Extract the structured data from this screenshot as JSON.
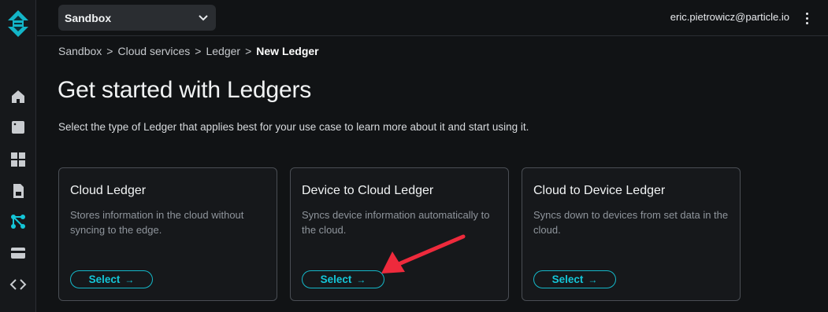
{
  "topbar": {
    "org_selector": "Sandbox",
    "user_email": "eric.pietrowicz@particle.io"
  },
  "breadcrumb": [
    "Sandbox",
    "Cloud services",
    "Ledger",
    "New Ledger"
  ],
  "page": {
    "title": "Get started with Ledgers",
    "subtitle": "Select the type of Ledger that applies best for your use case to learn more about it and start using it."
  },
  "cards": [
    {
      "title": "Cloud Ledger",
      "description": "Stores information in the cloud without syncing to the edge.",
      "button": "Select"
    },
    {
      "title": "Device to Cloud Ledger",
      "description": "Syncs device information automatically to the cloud.",
      "button": "Select"
    },
    {
      "title": "Cloud to Device Ledger",
      "description": "Syncs down to devices from set data in the cloud.",
      "button": "Select"
    }
  ],
  "sidebar": {
    "icons": [
      "home-icon",
      "device-icon",
      "grid-icon",
      "document-icon",
      "cloud-services-icon",
      "billing-icon",
      "code-icon"
    ]
  },
  "colors": {
    "accent": "#14c6d8",
    "background": "#111315",
    "annotation": "#ee2a3c"
  }
}
